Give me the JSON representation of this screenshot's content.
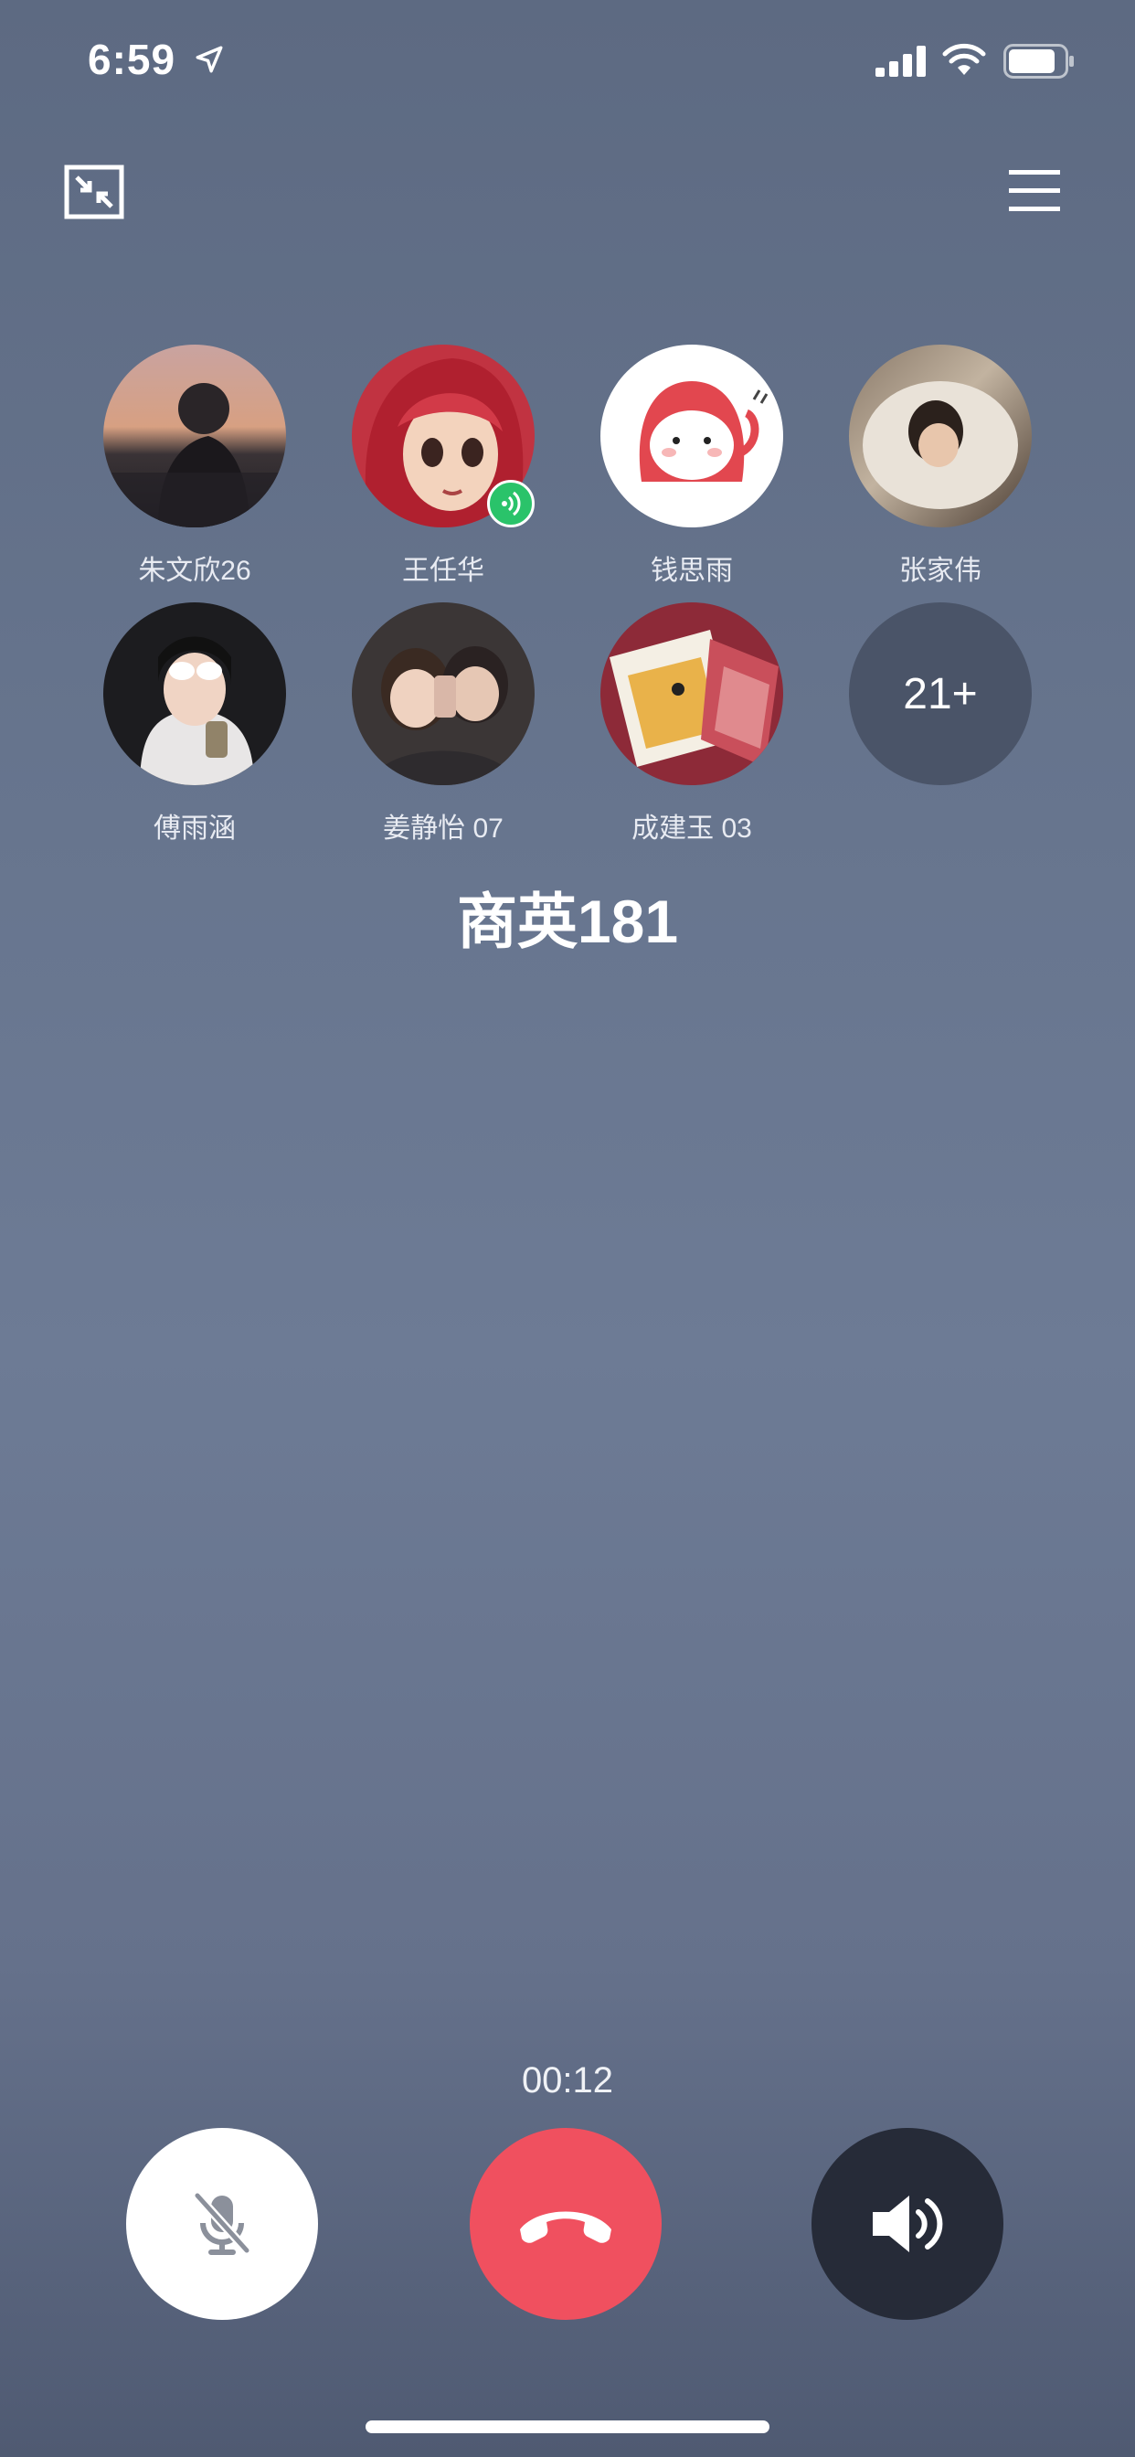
{
  "status_bar": {
    "time": "6:59",
    "icons": [
      "location-arrow-icon",
      "cellular-signal-icon",
      "wifi-icon",
      "battery-icon"
    ]
  },
  "top_controls": {
    "minimize_icon": "minimize-window-icon",
    "menu_icon": "menu-icon"
  },
  "participants": [
    {
      "name": "朱文欣26",
      "speaking": false
    },
    {
      "name": "王任华",
      "speaking": true
    },
    {
      "name": "钱思雨",
      "speaking": false
    },
    {
      "name": "张家伟",
      "speaking": false
    },
    {
      "name": "傅雨涵",
      "speaking": false
    },
    {
      "name": "姜静怡 07",
      "speaking": false
    },
    {
      "name": "成建玉 03",
      "speaking": false
    }
  ],
  "more_participants": "21+",
  "group_name": "商英181",
  "call_timer": "00:12",
  "controls": {
    "mute_icon": "microphone-muted-icon",
    "hangup_icon": "hang-up-phone-icon",
    "speaker_icon": "speaker-icon"
  },
  "colors": {
    "hangup": "#f0505f",
    "speaker_bg": "#262b38",
    "speaking_badge": "#2ac36a"
  }
}
